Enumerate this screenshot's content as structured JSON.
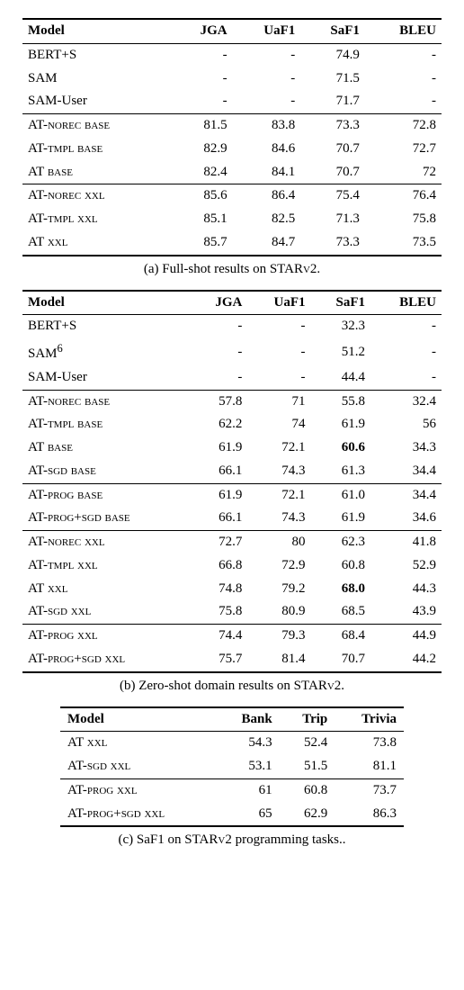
{
  "table_a": {
    "headers": [
      "Model",
      "JGA",
      "UaF1",
      "SaF1",
      "BLEU"
    ],
    "groups": [
      [
        {
          "model": "BERT+S",
          "jga": "-",
          "uaf1": "-",
          "saf1": "74.9",
          "bleu": "-"
        },
        {
          "model": "SAM",
          "jga": "-",
          "uaf1": "-",
          "saf1": "71.5",
          "bleu": "-"
        },
        {
          "model": "SAM-User",
          "jga": "-",
          "uaf1": "-",
          "saf1": "71.7",
          "bleu": "-"
        }
      ],
      [
        {
          "model": "AT-<span class='sc'>norec base</span>",
          "jga": "81.5",
          "uaf1": "83.8",
          "saf1": "73.3",
          "bleu": "72.8"
        },
        {
          "model": "AT-<span class='sc'>tmpl base</span>",
          "jga": "82.9",
          "uaf1": "84.6",
          "saf1": "70.7",
          "bleu": "72.7"
        },
        {
          "model": "AT <span class='sc'>base</span>",
          "jga": "82.4",
          "uaf1": "84.1",
          "saf1": "70.7",
          "bleu": "72"
        }
      ],
      [
        {
          "model": "AT-<span class='sc'>norec xxl</span>",
          "jga": "85.6",
          "uaf1": "86.4",
          "saf1": "75.4",
          "bleu": "76.4"
        },
        {
          "model": "AT-<span class='sc'>tmpl xxl</span>",
          "jga": "85.1",
          "uaf1": "82.5",
          "saf1": "71.3",
          "bleu": "75.8"
        },
        {
          "model": "AT <span class='sc'>xxl</span>",
          "jga": "85.7",
          "uaf1": "84.7",
          "saf1": "73.3",
          "bleu": "73.5"
        }
      ]
    ],
    "caption": "(a) Full-shot results on STAR<span class='sc'>v</span>2."
  },
  "table_b": {
    "headers": [
      "Model",
      "JGA",
      "UaF1",
      "SaF1",
      "BLEU"
    ],
    "groups": [
      [
        {
          "model": "BERT+S",
          "jga": "-",
          "uaf1": "-",
          "saf1": "32.3",
          "bleu": "-"
        },
        {
          "model": "SAM<sup>6</sup>",
          "jga": "-",
          "uaf1": "-",
          "saf1": "51.2",
          "bleu": "-"
        },
        {
          "model": "SAM-User",
          "jga": "-",
          "uaf1": "-",
          "saf1": "44.4",
          "bleu": "-"
        }
      ],
      [
        {
          "model": "AT-<span class='sc'>norec base</span>",
          "jga": "57.8",
          "uaf1": "71",
          "saf1": "55.8",
          "bleu": "32.4"
        },
        {
          "model": "AT-<span class='sc'>tmpl base</span>",
          "jga": "62.2",
          "uaf1": "74",
          "saf1": "61.9",
          "bleu": "56"
        },
        {
          "model": "AT <span class='sc'>base</span>",
          "jga": "61.9",
          "uaf1": "72.1",
          "saf1": "<span class='bold'>60.6</span>",
          "bleu": "34.3"
        },
        {
          "model": "AT-<span class='sc'>sgd base</span>",
          "jga": "66.1",
          "uaf1": "74.3",
          "saf1": "61.3",
          "bleu": "34.4"
        }
      ],
      [
        {
          "model": "AT-<span class='sc'>prog base</span>",
          "jga": "61.9",
          "uaf1": "72.1",
          "saf1": "61.0",
          "bleu": "34.4"
        },
        {
          "model": "AT-<span class='sc'>prog+sgd base</span>",
          "jga": "66.1",
          "uaf1": "74.3",
          "saf1": "61.9",
          "bleu": "34.6"
        }
      ],
      [
        {
          "model": "AT-<span class='sc'>norec xxl</span>",
          "jga": "72.7",
          "uaf1": "80",
          "saf1": "62.3",
          "bleu": "41.8"
        },
        {
          "model": "AT-<span class='sc'>tmpl xxl</span>",
          "jga": "66.8",
          "uaf1": "72.9",
          "saf1": "60.8",
          "bleu": "52.9"
        },
        {
          "model": "AT <span class='sc'>xxl</span>",
          "jga": "74.8",
          "uaf1": "79.2",
          "saf1": "<span class='bold'>68.0</span>",
          "bleu": "44.3"
        },
        {
          "model": "AT-<span class='sc'>sgd xxl</span>",
          "jga": "75.8",
          "uaf1": "80.9",
          "saf1": "68.5",
          "bleu": "43.9"
        }
      ],
      [
        {
          "model": "AT-<span class='sc'>prog xxl</span>",
          "jga": "74.4",
          "uaf1": "79.3",
          "saf1": "68.4",
          "bleu": "44.9"
        },
        {
          "model": "AT-<span class='sc'>prog+sgd xxl</span>",
          "jga": "75.7",
          "uaf1": "81.4",
          "saf1": "70.7",
          "bleu": "44.2"
        }
      ]
    ],
    "caption": "(b) Zero-shot domain results on STAR<span class='sc'>v</span>2."
  },
  "table_c": {
    "headers": [
      "Model",
      "Bank",
      "Trip",
      "Trivia"
    ],
    "groups": [
      [
        {
          "model": "AT <span class='sc'>xxl</span>",
          "c1": "54.3",
          "c2": "52.4",
          "c3": "73.8"
        },
        {
          "model": "AT-<span class='sc'>sgd xxl</span>",
          "c1": "53.1",
          "c2": "51.5",
          "c3": "81.1"
        }
      ],
      [
        {
          "model": "AT-<span class='sc'>prog xxl</span>",
          "c1": "61",
          "c2": "60.8",
          "c3": "73.7"
        },
        {
          "model": "AT-<span class='sc'>prog+sgd xxl</span>",
          "c1": "65",
          "c2": "62.9",
          "c3": "86.3"
        }
      ]
    ],
    "caption": "(c) SaF1 on STAR<span class='sc'>v</span>2 programming tasks.."
  }
}
